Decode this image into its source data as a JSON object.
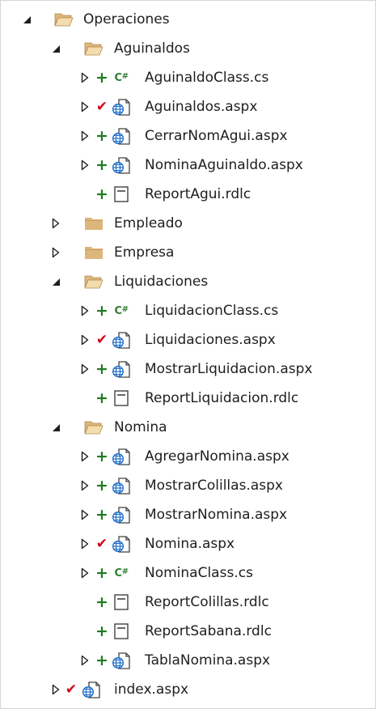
{
  "colors": {
    "folder_fill": "#dcb67a",
    "added_status": "#1f7a1f",
    "checked_status": "#d0021b",
    "csharp": "#2e7d32",
    "aspx_globe": "#1e6ec8",
    "text": "#1e1e1e"
  },
  "tree": [
    {
      "depth": 0,
      "expander": "expanded",
      "status": "",
      "icon": "folder-open-icon",
      "label": "Operaciones"
    },
    {
      "depth": 1,
      "expander": "expanded",
      "status": "",
      "icon": "folder-open-icon",
      "label": "Aguinaldos"
    },
    {
      "depth": 2,
      "expander": "collapsed",
      "status": "added",
      "icon": "csharp-file-icon",
      "label": "AguinaldoClass.cs"
    },
    {
      "depth": 2,
      "expander": "collapsed",
      "status": "checked",
      "icon": "aspx-file-icon",
      "label": "Aguinaldos.aspx"
    },
    {
      "depth": 2,
      "expander": "collapsed",
      "status": "added",
      "icon": "aspx-file-icon",
      "label": "CerrarNomAgui.aspx"
    },
    {
      "depth": 2,
      "expander": "collapsed",
      "status": "added",
      "icon": "aspx-file-icon",
      "label": "NominaAguinaldo.aspx"
    },
    {
      "depth": 2,
      "expander": "none",
      "status": "added",
      "icon": "report-file-icon",
      "label": "ReportAgui.rdlc"
    },
    {
      "depth": 1,
      "expander": "collapsed",
      "status": "",
      "icon": "folder-closed-icon",
      "label": "Empleado"
    },
    {
      "depth": 1,
      "expander": "collapsed",
      "status": "",
      "icon": "folder-closed-icon",
      "label": "Empresa"
    },
    {
      "depth": 1,
      "expander": "expanded",
      "status": "",
      "icon": "folder-open-icon",
      "label": "Liquidaciones"
    },
    {
      "depth": 2,
      "expander": "collapsed",
      "status": "added",
      "icon": "csharp-file-icon",
      "label": "LiquidacionClass.cs"
    },
    {
      "depth": 2,
      "expander": "collapsed",
      "status": "checked",
      "icon": "aspx-file-icon",
      "label": "Liquidaciones.aspx"
    },
    {
      "depth": 2,
      "expander": "collapsed",
      "status": "added",
      "icon": "aspx-file-icon",
      "label": "MostrarLiquidacion.aspx"
    },
    {
      "depth": 2,
      "expander": "none",
      "status": "added",
      "icon": "report-file-icon",
      "label": "ReportLiquidacion.rdlc"
    },
    {
      "depth": 1,
      "expander": "expanded",
      "status": "",
      "icon": "folder-open-icon",
      "label": "Nomina"
    },
    {
      "depth": 2,
      "expander": "collapsed",
      "status": "added",
      "icon": "aspx-file-icon",
      "label": "AgregarNomina.aspx"
    },
    {
      "depth": 2,
      "expander": "collapsed",
      "status": "added",
      "icon": "aspx-file-icon",
      "label": "MostrarColillas.aspx"
    },
    {
      "depth": 2,
      "expander": "collapsed",
      "status": "added",
      "icon": "aspx-file-icon",
      "label": "MostrarNomina.aspx"
    },
    {
      "depth": 2,
      "expander": "collapsed",
      "status": "checked",
      "icon": "aspx-file-icon",
      "label": "Nomina.aspx"
    },
    {
      "depth": 2,
      "expander": "collapsed",
      "status": "added",
      "icon": "csharp-file-icon",
      "label": "NominaClass.cs"
    },
    {
      "depth": 2,
      "expander": "none",
      "status": "added",
      "icon": "report-file-icon",
      "label": "ReportColillas.rdlc"
    },
    {
      "depth": 2,
      "expander": "none",
      "status": "added",
      "icon": "report-file-icon",
      "label": "ReportSabana.rdlc"
    },
    {
      "depth": 2,
      "expander": "collapsed",
      "status": "added",
      "icon": "aspx-file-icon",
      "label": "TablaNomina.aspx"
    },
    {
      "depth": 1,
      "expander": "collapsed",
      "status": "checked",
      "icon": "aspx-file-icon",
      "label": "index.aspx"
    }
  ]
}
